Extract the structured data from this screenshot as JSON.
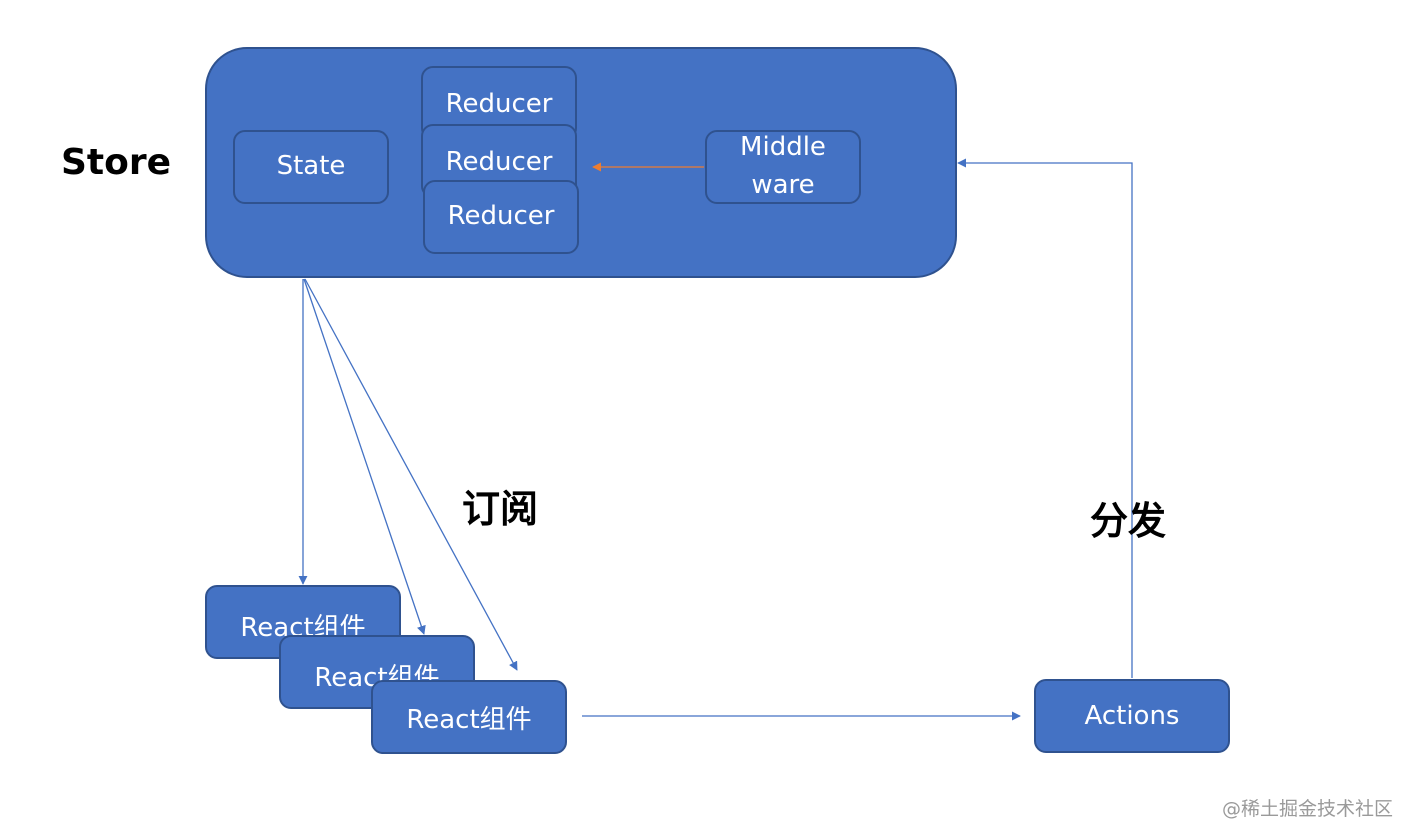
{
  "diagram": {
    "store": {
      "label": "Store",
      "color": "#4472c4",
      "border_color": "#2f528f"
    },
    "nodes": {
      "state": "State",
      "reducers": [
        "Reducer",
        "Reducer",
        "Reducer"
      ],
      "middleware": [
        "Middle",
        "ware"
      ],
      "react_components": [
        "React组件",
        "React组件",
        "React组件"
      ],
      "actions": "Actions"
    },
    "edges": [
      {
        "from": "store",
        "to": "react-component-1",
        "label": "订阅"
      },
      {
        "from": "store",
        "to": "react-component-2",
        "label": "订阅"
      },
      {
        "from": "store",
        "to": "react-component-3",
        "label": "订阅"
      },
      {
        "from": "react-component-3",
        "to": "actions",
        "label": ""
      },
      {
        "from": "actions",
        "to": "store",
        "label": "分发"
      },
      {
        "from": "middleware",
        "to": "reducer",
        "label": "",
        "color": "#ed7d31"
      }
    ],
    "labels": {
      "subscribe": "订阅",
      "dispatch": "分发"
    },
    "edge_color": "#4472c4",
    "middleware_edge_color": "#ed7d31"
  },
  "watermark": "@稀土掘金技术社区"
}
